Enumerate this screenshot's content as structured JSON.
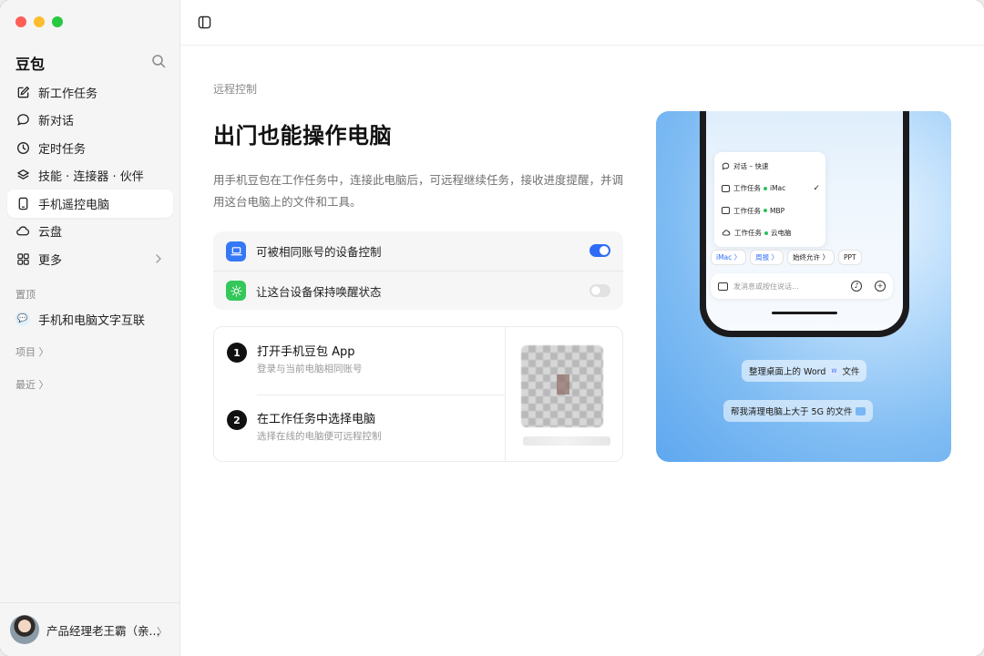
{
  "window": {
    "traffic_colors": [
      "#fe5f57",
      "#febc2e",
      "#28c840"
    ]
  },
  "sidebar": {
    "brand": "豆包",
    "items": [
      {
        "label": "新工作任务",
        "icon": "edit-icon"
      },
      {
        "label": "新对话",
        "icon": "chat-bubble-icon"
      },
      {
        "label": "定时任务",
        "icon": "clock-icon"
      },
      {
        "label": "技能 · 连接器 · 伙伴",
        "icon": "layers-icon"
      },
      {
        "label": "手机遥控电脑",
        "icon": "phone-icon",
        "active": true
      },
      {
        "label": "云盘",
        "icon": "cloud-icon"
      },
      {
        "label": "更多",
        "icon": "grid-icon"
      }
    ],
    "pinned_label": "置顶",
    "pinned_item": "手机和电脑文字互联",
    "projects_label": "项目 〉",
    "recent_label": "最近 〉",
    "user_name": "产品经理老王霸（亲..."
  },
  "main": {
    "eyebrow": "远程控制",
    "headline": "出门也能操作电脑",
    "description": "用手机豆包在工作任务中，连接此电脑后，可远程继续任务，接收进度提醒，并调用这台电脑上的文件和工具。",
    "toggles": [
      {
        "label": "可被相同账号的设备控制",
        "on": true,
        "icon": "laptop-icon",
        "icon_color": "#3478f6"
      },
      {
        "label": "让这台设备保持唤醒状态",
        "on": false,
        "icon": "sun-icon",
        "icon_color": "#34c759"
      }
    ],
    "steps": [
      {
        "num": "1",
        "title": "打开手机豆包 App",
        "sub": "登录与当前电脑相同账号"
      },
      {
        "num": "2",
        "title": "在工作任务中选择电脑",
        "sub": "选择在线的电脑便可远程控制"
      }
    ]
  },
  "promo": {
    "menu": [
      {
        "label": "对话 – 快速",
        "icon": "chat",
        "dot": false,
        "check": false
      },
      {
        "label": "工作任务",
        "suffix": "iMac",
        "dot": true,
        "check": true
      },
      {
        "label": "工作任务",
        "suffix": "MBP",
        "dot": true,
        "check": false
      },
      {
        "label": "工作任务",
        "suffix": "云电脑",
        "dot": true,
        "check": false
      }
    ],
    "chips": [
      "iMac 〉",
      "周报 〉",
      "始终允许 〉",
      "PPT"
    ],
    "input_placeholder": "发消息或按住说话...",
    "pill1_prefix": "整理桌面上的 Word",
    "pill1_badge": "W",
    "pill1_suffix": "文件",
    "pill2": "帮我清理电脑上大于 5G 的文件"
  }
}
